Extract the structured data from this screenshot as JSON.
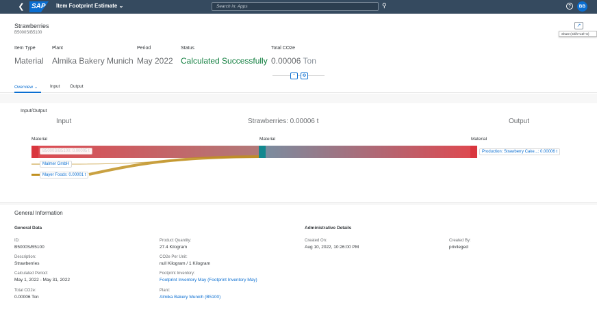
{
  "shell": {
    "back_icon": "back-icon",
    "logo": "SAP",
    "app_title": "Item Footprint Estimate",
    "search_placeholder": "Search in: Apps",
    "help_icon": "help-icon",
    "avatar_initials": "BB"
  },
  "header": {
    "title": "Strawberries",
    "subtitle": "B5000S/B5100",
    "share_tooltip": "Share (Shift+Ctrl+S)",
    "kpis": [
      {
        "label": "Item Type",
        "value": "Material"
      },
      {
        "label": "Plant",
        "value": "Almika Bakery Munich"
      },
      {
        "label": "Period",
        "value": "May 2022"
      },
      {
        "label": "Status",
        "value": "Calculated Successfully"
      },
      {
        "label": "Total CO2e",
        "value": "0.00006",
        "unit": "Ton"
      }
    ]
  },
  "tabs": [
    {
      "label": "Overview",
      "active": true
    },
    {
      "label": "Input"
    },
    {
      "label": "Output"
    }
  ],
  "io": {
    "section_title": "Input/Output",
    "input_heading": "Input",
    "center_heading": "Strawberries: 0.00006 t",
    "output_heading": "Output",
    "left_material_label": "Material",
    "center_material_label": "Material",
    "right_material_label": "Material",
    "inputs": [
      {
        "label": "B5000S/B5100: 0.00005 t",
        "value": 5e-05
      },
      {
        "label": "Malmer GmbH",
        "value": 0.0
      },
      {
        "label": "Mayer Foods: 0.00001 t",
        "value": 1e-05
      }
    ],
    "output": {
      "label": "Production: Strawberry Cake...: 0.00006 t",
      "value": 6e-05
    },
    "colors": {
      "red": "#d9363e",
      "teal": "#13888f",
      "gold": "#c09020",
      "gray": "#6c7f94"
    }
  },
  "general": {
    "section_title": "General Information",
    "general_data_title": "General Data",
    "admin_title": "Administrative Details",
    "fields_col1": [
      {
        "label": "ID:",
        "value": "B5000S/B5100"
      },
      {
        "label": "Description:",
        "value": "Strawberries"
      },
      {
        "label": "Calculated Period:",
        "value": "May 1, 2022 - May 31, 2022"
      },
      {
        "label": "Total CO2e:",
        "value": "0.00006 Ton"
      }
    ],
    "fields_col2": [
      {
        "label": "Product Quantity:",
        "value": "27.4 Kilogram"
      },
      {
        "label": "CO2e Per Unit:",
        "value": "null Kilogram / 1 Kilogram"
      },
      {
        "label": "Footprint Inventory:",
        "value": "Footprint Inventory May (Footprint Inventory May)"
      },
      {
        "label": "Plant:",
        "value": "Almika Bakery Munich (B5100)"
      }
    ],
    "created_on_label": "Created On:",
    "created_on_value": "Aug 10, 2022, 10:26:00 PM",
    "created_by_label": "Created By:",
    "created_by_value": "privileged"
  }
}
